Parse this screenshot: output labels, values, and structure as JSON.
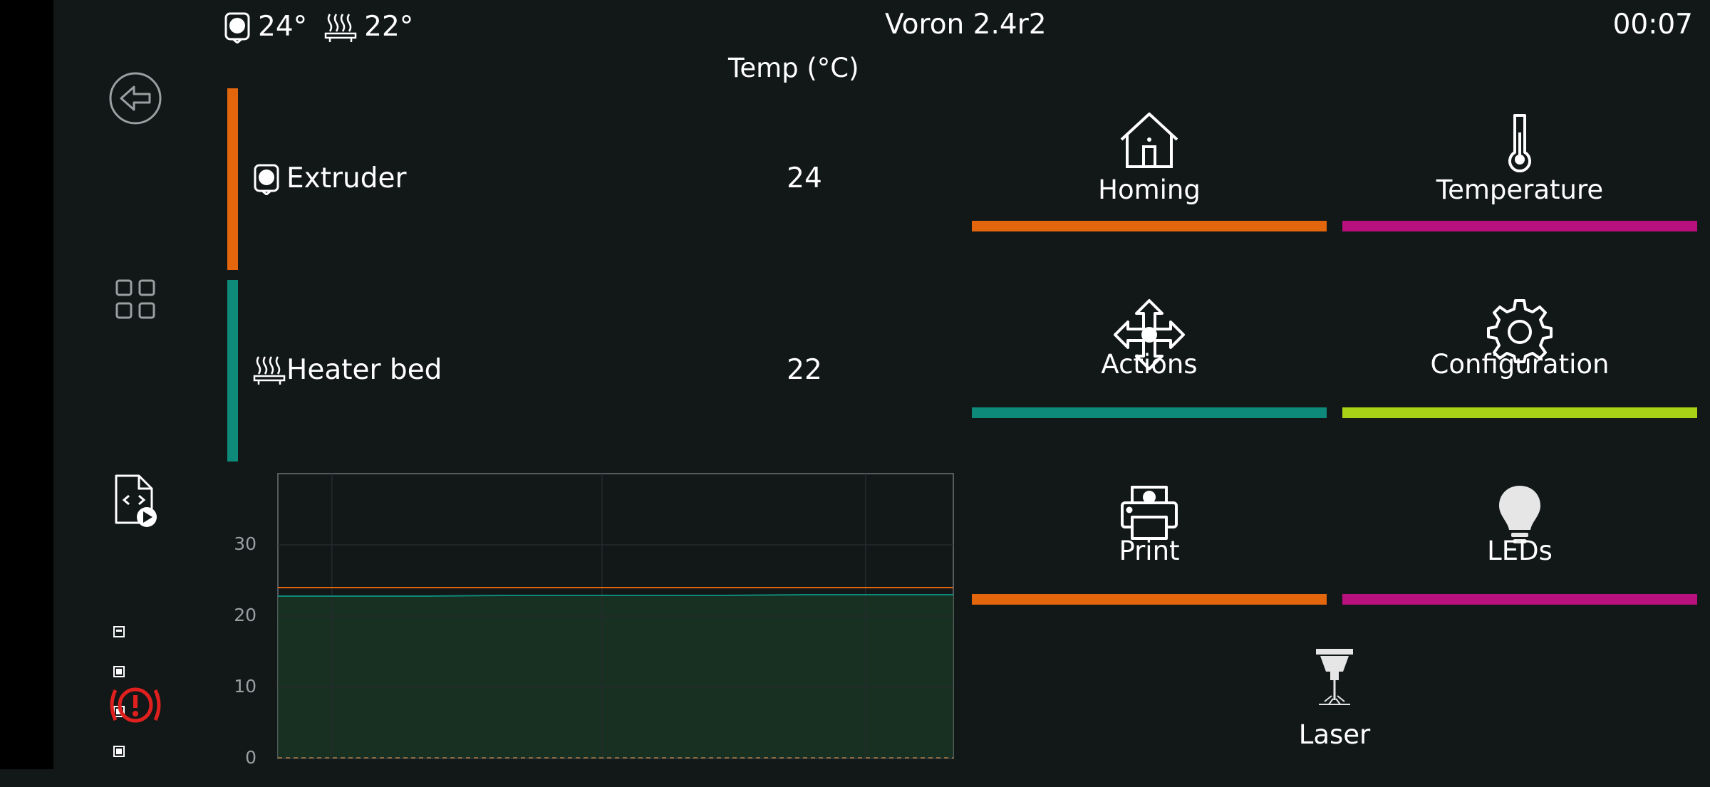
{
  "topbar": {
    "extruder_temp": "24°",
    "bed_temp": "22°",
    "printer_name": "Voron 2.4r2",
    "clock": "00:07"
  },
  "sidebar": {
    "items": [
      {
        "icon": "back-icon"
      },
      {
        "icon": "grid-menu-icon"
      },
      {
        "icon": "gcode-file-icon"
      },
      {
        "icon": "emergency-stop-icon"
      }
    ]
  },
  "temperature_panel": {
    "heading": "Temp (°C)",
    "heaters": [
      {
        "name": "Extruder",
        "temp": "24",
        "color": "#e3660d",
        "icon": "extruder-icon"
      },
      {
        "name": "Heater bed",
        "temp": "22",
        "color": "#0e8a7a",
        "icon": "heater-bed-icon"
      }
    ]
  },
  "chart_data": {
    "type": "line",
    "title": "",
    "xlabel": "",
    "ylabel": "",
    "ylim": [
      0,
      40
    ],
    "yticks": [
      "30",
      "20",
      "10",
      "0"
    ],
    "grid": true,
    "series": [
      {
        "name": "Extruder",
        "color": "#e3660d",
        "values": [
          24,
          24,
          24,
          24,
          24,
          24,
          24,
          24,
          24,
          24
        ]
      },
      {
        "name": "Heater bed",
        "color": "#0e8a7a",
        "values": [
          22.8,
          22.8,
          22.8,
          22.9,
          22.9,
          22.9,
          22.9,
          23,
          23,
          23
        ]
      }
    ]
  },
  "menu": {
    "items": [
      {
        "label": "Homing",
        "icon": "home-icon",
        "color": "#e3660d"
      },
      {
        "label": "Temperature",
        "icon": "thermometer-icon",
        "color": "#b8107c"
      },
      {
        "label": "Actions",
        "icon": "move-arrows-icon",
        "color": "#0e8a7a"
      },
      {
        "label": "Configuration",
        "icon": "gear-icon",
        "color": "#a8d216"
      },
      {
        "label": "Print",
        "icon": "printer-icon",
        "color": "#e3660d"
      },
      {
        "label": "LEDs",
        "icon": "lightbulb-icon",
        "color": "#b8107c"
      },
      {
        "label": "Laser",
        "icon": "laser-icon",
        "color": ""
      }
    ]
  }
}
